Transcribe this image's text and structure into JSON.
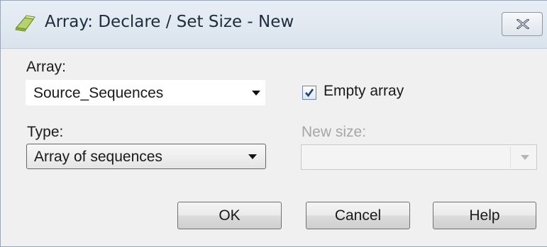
{
  "window": {
    "title": "Array: Declare / Set Size - New",
    "icon": "array-edit-icon",
    "close_icon": "close-icon"
  },
  "form": {
    "array_label": "Array:",
    "array_value": "Source_Sequences",
    "empty_array": {
      "label": "Empty array",
      "checked": true
    },
    "type_label": "Type:",
    "type_value": "Array of sequences",
    "new_size_label": "New size:",
    "new_size_value": "",
    "new_size_enabled": false
  },
  "buttons": {
    "ok": "OK",
    "cancel": "Cancel",
    "help": "Help"
  },
  "colors": {
    "titlebar": "#dae3ec",
    "dialog_bg": "#f0f0f0",
    "disabled_text": "#a6a6a6"
  }
}
